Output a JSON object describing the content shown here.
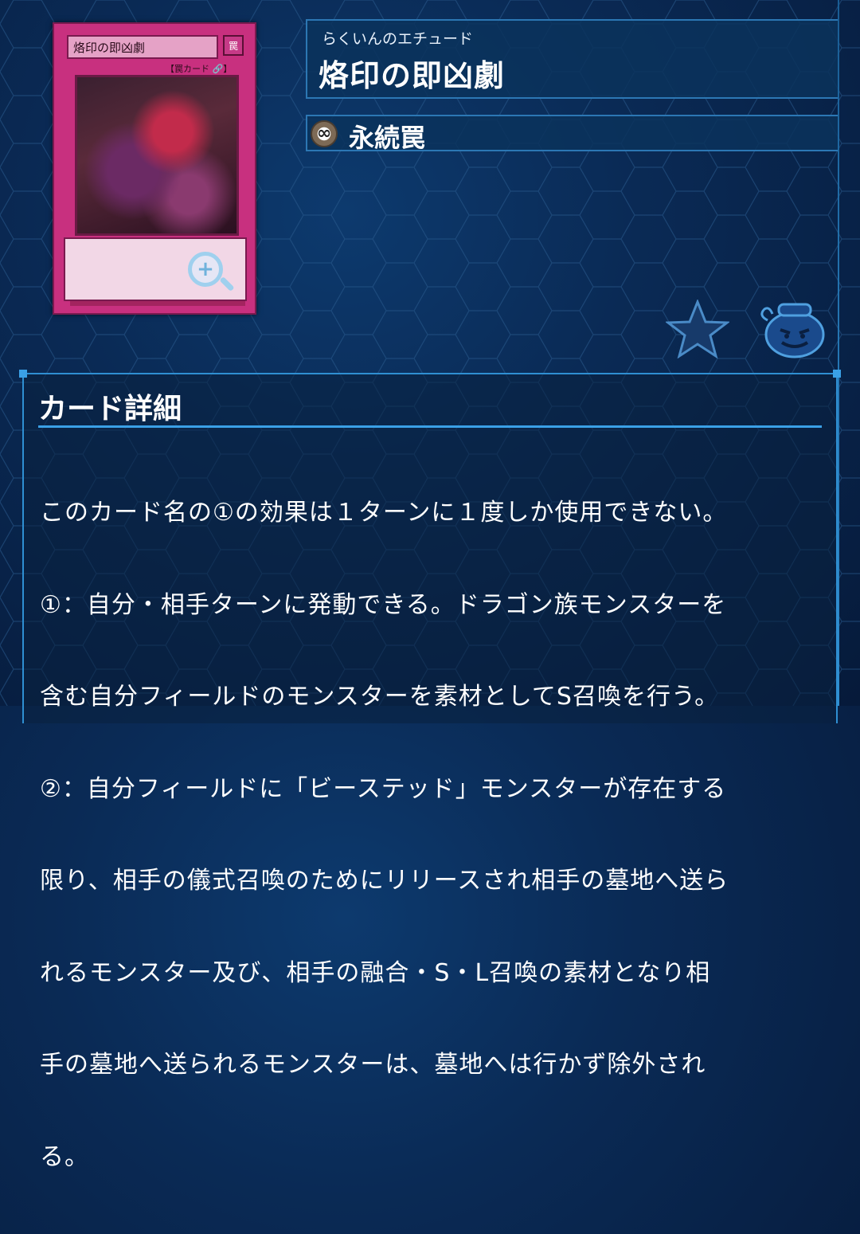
{
  "card": {
    "image": {
      "name_text": "烙印の即凶劇",
      "attribute_text": "罠",
      "type_text": "【罠カード 🔗】"
    },
    "ruby": "らくいんのエチュード",
    "name": "烙印の即凶劇",
    "type_label": "永続罠",
    "type_icon": "continuous-trap-icon"
  },
  "actions": {
    "zoom_icon": "zoom-in-icon",
    "favorite_icon": "star-icon",
    "deck_icon": "pot-of-greed-icon"
  },
  "details": {
    "heading": "カード詳細",
    "lines": [
      "このカード名の①の効果は１ターンに１度しか使用できない。",
      "①：自分・相手ターンに発動できる。ドラゴン族モンスターを",
      "含む自分フィールドのモンスターを素材としてS召喚を行う。",
      "②：自分フィールドに「ビーステッド」モンスターが存在する",
      "限り、相手の儀式召喚のためにリリースされ相手の墓地へ送ら",
      "れるモンスター及び、相手の融合・S・L召喚の素材となり相",
      "手の墓地へ送られるモンスターは、墓地へは行かず除外され",
      "る。"
    ]
  },
  "colors": {
    "background": "#0a2a55",
    "panel_border": "#2f8fd2",
    "trap_card": "#c8307f"
  }
}
